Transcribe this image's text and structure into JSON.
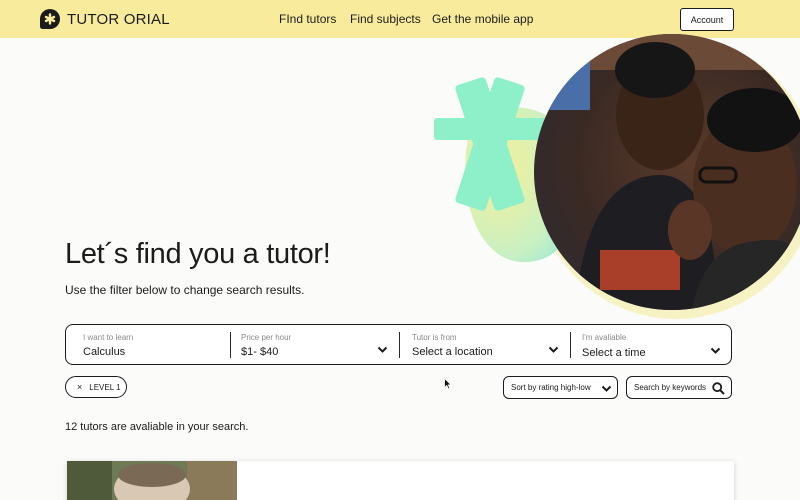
{
  "header": {
    "logo_text": "TUTOR ORIAL",
    "nav": [
      "FInd tutors",
      "Find subjects",
      "Get the mobile app"
    ],
    "account_label": "Account"
  },
  "hero": {
    "title": "Let´s find you a tutor!",
    "subtitle": "Use the filter below to change search results."
  },
  "filters": [
    {
      "label": "I want to learn",
      "value": "Calculus"
    },
    {
      "label": "Price per hour",
      "value": "$1- $40"
    },
    {
      "label": "Tutor is from",
      "value": "Select a location"
    },
    {
      "label": "I'm avaliable",
      "value": "Select a time"
    }
  ],
  "chips": {
    "level_label": "LEVEL 1",
    "remove_icon": "×"
  },
  "sort": {
    "label": "Sort by rating high-low"
  },
  "search": {
    "placeholder": "Search by keywords"
  },
  "results": {
    "count_text": "12 tutors are avaliable in your search."
  },
  "colors": {
    "header_bg": "#f8ec9c",
    "accent_mint": "#8ef0c8",
    "accent_yellow": "#f5e98a",
    "text": "#1b1b1b"
  },
  "icons": {
    "logo": "asterisk-logo-icon",
    "chevron": "chevron-down-icon",
    "search": "search-icon",
    "cursor": "mouse-pointer-icon"
  }
}
